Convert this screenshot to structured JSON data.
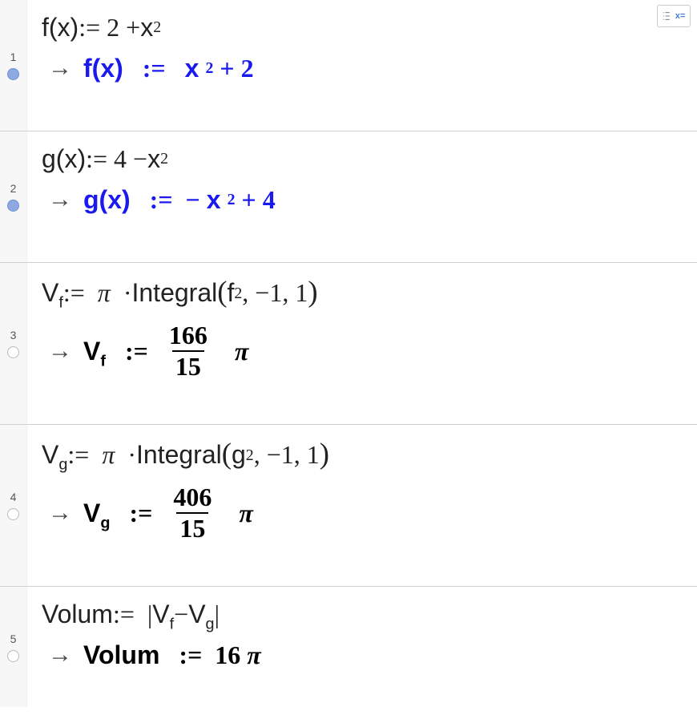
{
  "toolbar": {
    "substitute_label": "x="
  },
  "rows": [
    {
      "num": "1",
      "filled": true,
      "input_html": "<span class='sans'>f(x)</span> := 2 + <span class='sans'>x</span><sup>2</sup>",
      "result_html": "<span class='sans'>f(x)</span>&nbsp; := &nbsp;<span class='sans'>x</span><sup>2</sup> + 2",
      "result_color": "blue"
    },
    {
      "num": "2",
      "filled": true,
      "input_html": "<span class='sans'>g(x)</span> := 4 − <span class='sans'>x</span><sup>2</sup>",
      "result_html": "<span class='sans'>g(x)</span>&nbsp; := &nbsp;−<span class='sans'>x</span><sup>2</sup> + 4",
      "result_color": "blue"
    },
    {
      "num": "3",
      "filled": false,
      "input_html": "<span class='sans'>V<sub>f</sub></span> := &nbsp;<span class='italic'>π</span>&nbsp; · <span class='sans'>Integral</span><span class='big-paren'>(</span><span class='sans'>f</span><sup>2</sup>, −1, 1<span class='big-paren'>)</span>",
      "result_html": "<span class='sans'>V<sub>f</sub></span>&nbsp; :=&nbsp; <span class='frac'><span class='num'>166</span><span class='den'>15</span></span>&nbsp;<span class='pi'>π</span>",
      "result_color": "black"
    },
    {
      "num": "4",
      "filled": false,
      "input_html": "<span class='sans'>V<sub>g</sub></span> := &nbsp;<span class='italic'>π</span>&nbsp; · <span class='sans'>Integral</span><span class='big-paren'>(</span><span class='sans'>g</span><sup>2</sup>, −1, 1<span class='big-paren'>)</span>",
      "result_html": "<span class='sans'>V<sub>g</sub></span>&nbsp; :=&nbsp; <span class='frac'><span class='num'>406</span><span class='den'>15</span></span>&nbsp;<span class='pi'>π</span>",
      "result_color": "black"
    },
    {
      "num": "5",
      "filled": false,
      "input_html": "<span class='sans'>Volum</span> := &nbsp;<span class='abs-bar'>|</span><span class='sans'>V<sub>f</sub></span> − <span class='sans'>V<sub>g</sub></span><span class='abs-bar'>|</span>",
      "result_html": "<span class='sans'>Volum</span>&nbsp; := &nbsp;16 <span class='pi'>π</span>",
      "result_color": "black"
    }
  ]
}
